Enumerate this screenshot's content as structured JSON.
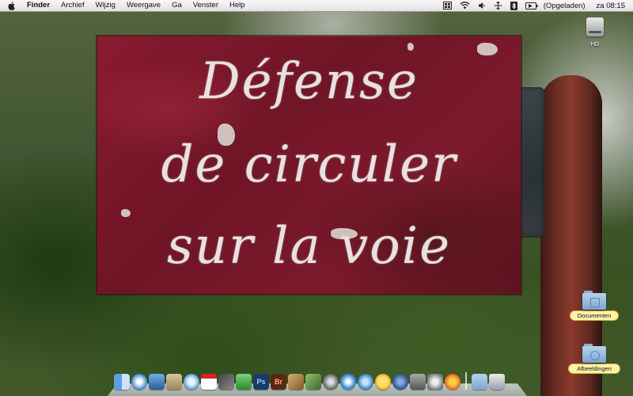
{
  "menubar": {
    "apple_icon": "apple-logo",
    "app_name": "Finder",
    "items": [
      "Archief",
      "Wijzig",
      "Weergave",
      "Ga",
      "Venster",
      "Help"
    ],
    "status": {
      "battery_label": "(Opgeladen)",
      "clock": "za 08:15"
    }
  },
  "wallpaper": {
    "sign_lines": [
      "Défense",
      "de circuler",
      "sur la voie"
    ]
  },
  "desktop_icons": {
    "hd": "HD",
    "documents": "Documenten",
    "pictures": "Afbeeldingen"
  },
  "dock": {
    "icons": [
      "finder-icon",
      "safari-icon",
      "preview-icon",
      "mail-stamp-icon",
      "itunes-icon",
      "calendar-icon",
      "address-book-icon",
      "dashboard-icon",
      "photoshop-icon",
      "bridge-icon",
      "photo-icon",
      "iphoto-icon",
      "system-icon",
      "dvd-player-icon",
      "quicktime-icon",
      "adium-icon",
      "google-earth-icon",
      "network-icon",
      "system-preferences-icon",
      "firefox-icon",
      "documents-stack-icon",
      "trash-icon"
    ],
    "photoshop_label": "Ps",
    "bridge_label": "Br"
  },
  "colors": {
    "menubar": "#e9e9e9",
    "sign_red": "#7c1a2c",
    "label_highlight": "#fff3a8"
  }
}
